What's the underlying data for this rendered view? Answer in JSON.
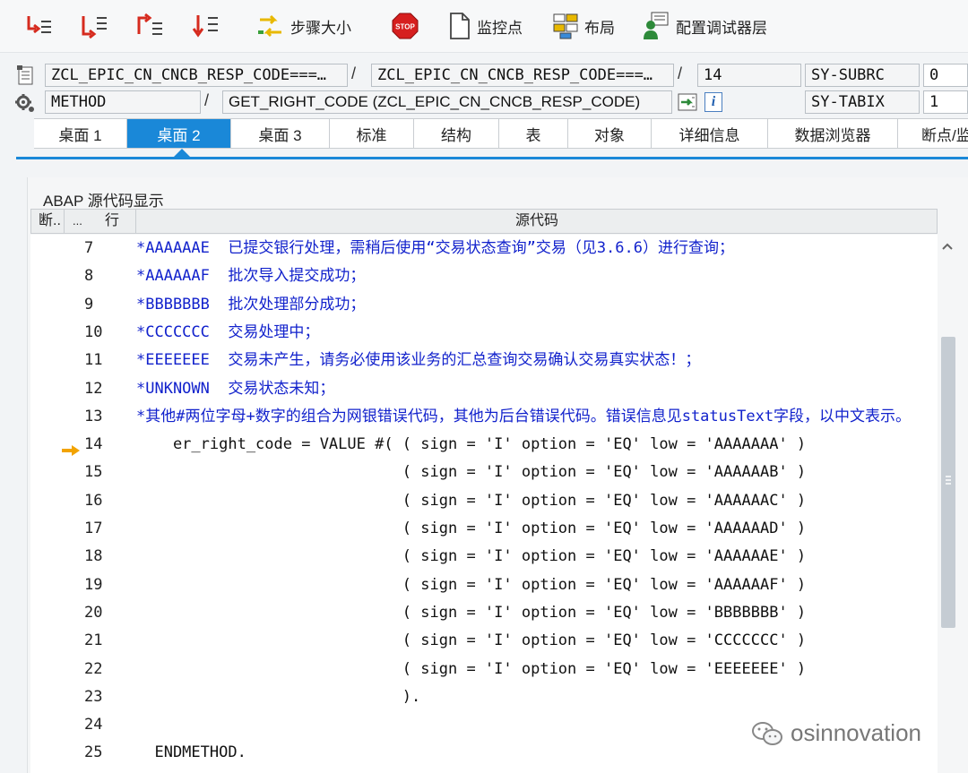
{
  "toolbar": {
    "step_size": "步骤大小",
    "stop_label": "STOP",
    "watchpoint": "监控点",
    "layout": "布局",
    "configure_layers": "配置调试器层"
  },
  "info": {
    "program": "ZCL_EPIC_CN_CNCB_RESP_CODE===…",
    "include": "ZCL_EPIC_CN_CNCB_RESP_CODE===…",
    "line": "14",
    "subrc_label": "SY-SUBRC",
    "subrc_value": "0",
    "event_type": "METHOD",
    "event": "GET_RIGHT_CODE (ZCL_EPIC_CN_CNCB_RESP_CODE)",
    "tabix_label": "SY-TABIX",
    "tabix_value": "1",
    "slash": "/",
    "info_glyph": "i"
  },
  "tabs": [
    "桌面 1",
    "桌面 2",
    "桌面 3",
    "标准",
    "结构",
    "表",
    "对象",
    "详细信息",
    "数据浏览器",
    "断点/监"
  ],
  "active_tab": 1,
  "panel": {
    "title": "ABAP 源代码显示",
    "col_break": "断..",
    "col_dots": "...",
    "col_line": "行",
    "col_source": "源代码"
  },
  "lines": [
    {
      "n": "7",
      "text": "*AAAAAAE  已提交银行处理，需稍后使用“交易状态查询”交易（见3.6.6）进行查询；",
      "comment": true
    },
    {
      "n": "8",
      "text": "*AAAAAAF  批次导入提交成功；",
      "comment": true
    },
    {
      "n": "9",
      "text": "*BBBBBBB  批次处理部分成功；",
      "comment": true
    },
    {
      "n": "10",
      "text": "*CCCCCCC  交易处理中；",
      "comment": true
    },
    {
      "n": "11",
      "text": "*EEEEEEE  交易未产生，请务必使用该业务的汇总查询交易确认交易真实状态！；",
      "comment": true
    },
    {
      "n": "12",
      "text": "*UNKNOWN  交易状态未知；",
      "comment": true
    },
    {
      "n": "13",
      "text": "*其他#两位字母+数字的组合为网银错误代码，其他为后台错误代码。错误信息见statusText字段，以中文表示。",
      "comment": true
    },
    {
      "n": "14",
      "text": "    er_right_code = VALUE #( ( sign = 'I' option = 'EQ' low = 'AAAAAAA' )",
      "comment": false,
      "current": true
    },
    {
      "n": "15",
      "text": "                             ( sign = 'I' option = 'EQ' low = 'AAAAAAB' )",
      "comment": false
    },
    {
      "n": "16",
      "text": "                             ( sign = 'I' option = 'EQ' low = 'AAAAAAC' )",
      "comment": false
    },
    {
      "n": "17",
      "text": "                             ( sign = 'I' option = 'EQ' low = 'AAAAAAD' )",
      "comment": false
    },
    {
      "n": "18",
      "text": "                             ( sign = 'I' option = 'EQ' low = 'AAAAAAE' )",
      "comment": false
    },
    {
      "n": "19",
      "text": "                             ( sign = 'I' option = 'EQ' low = 'AAAAAAF' )",
      "comment": false
    },
    {
      "n": "20",
      "text": "                             ( sign = 'I' option = 'EQ' low = 'BBBBBBB' )",
      "comment": false
    },
    {
      "n": "21",
      "text": "                             ( sign = 'I' option = 'EQ' low = 'CCCCCCC' )",
      "comment": false
    },
    {
      "n": "22",
      "text": "                             ( sign = 'I' option = 'EQ' low = 'EEEEEEE' )",
      "comment": false
    },
    {
      "n": "23",
      "text": "                             ).",
      "comment": false
    },
    {
      "n": "24",
      "text": "",
      "comment": false
    },
    {
      "n": "25",
      "text": "  ENDMETHOD.",
      "comment": false
    }
  ],
  "watermark": "osinnovation",
  "colors": {
    "accent": "#1a88d8",
    "comment": "#1222cc",
    "arrow": "#f2a300"
  }
}
